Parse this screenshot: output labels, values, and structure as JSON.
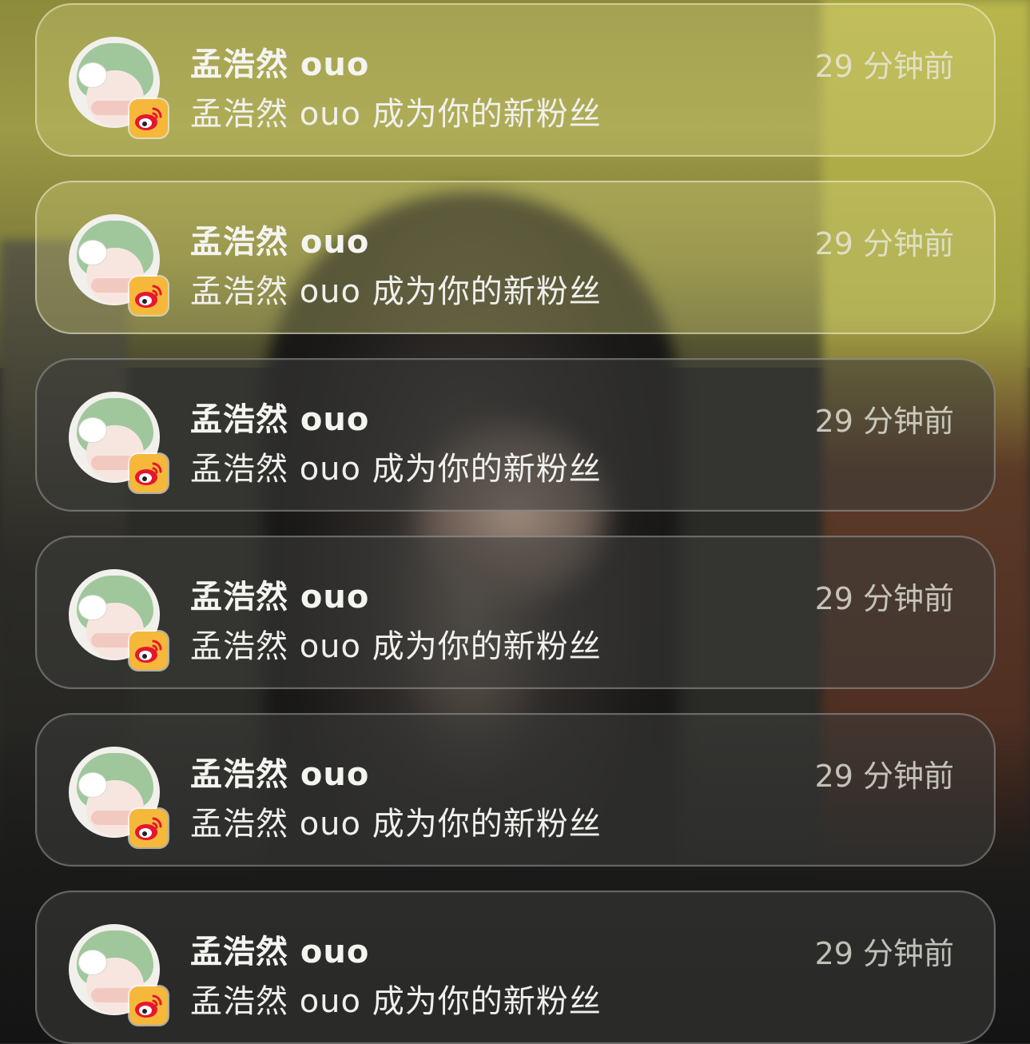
{
  "notifications": [
    {
      "app_icon": "weibo-icon",
      "title": "孟浩然 ouo",
      "body": "孟浩然 ouo 成为你的新粉丝",
      "time": "29 分钟前"
    },
    {
      "app_icon": "weibo-icon",
      "title": "孟浩然 ouo",
      "body": "孟浩然 ouo 成为你的新粉丝",
      "time": "29 分钟前"
    },
    {
      "app_icon": "weibo-icon",
      "title": "孟浩然 ouo",
      "body": "孟浩然 ouo 成为你的新粉丝",
      "time": "29 分钟前"
    },
    {
      "app_icon": "weibo-icon",
      "title": "孟浩然 ouo",
      "body": "孟浩然 ouo 成为你的新粉丝",
      "time": "29 分钟前"
    },
    {
      "app_icon": "weibo-icon",
      "title": "孟浩然 ouo",
      "body": "孟浩然 ouo 成为你的新粉丝",
      "time": "29 分钟前"
    },
    {
      "app_icon": "weibo-icon",
      "title": "孟浩然 ouo",
      "body": "孟浩然 ouo 成为你的新粉丝",
      "time": "29 分钟前"
    }
  ],
  "colors": {
    "weibo_badge": "#f5b83a",
    "weibo_logo_red": "#e6162d"
  }
}
